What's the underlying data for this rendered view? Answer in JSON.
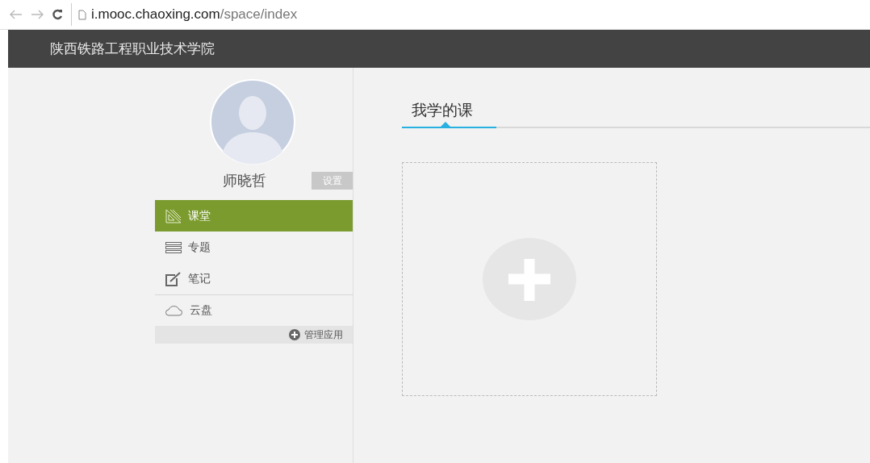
{
  "browser": {
    "url_host": "i.mooc.chaoxing.com",
    "url_path": "/space/index"
  },
  "header": {
    "title": "陕西铁路工程职业技术学院"
  },
  "profile": {
    "name": "师晓哲",
    "settings_button": "设置"
  },
  "menu": [
    {
      "label": "课堂",
      "kind": "ruler",
      "selected": true
    },
    {
      "label": "专题",
      "kind": "list",
      "selected": false
    },
    {
      "label": "笔记",
      "kind": "note",
      "selected": false
    },
    {
      "label": "云盘",
      "kind": "cloud",
      "selected": false
    }
  ],
  "manage_apps": "管理应用",
  "tabs": [
    {
      "label": "我学的课",
      "selected": true
    }
  ]
}
